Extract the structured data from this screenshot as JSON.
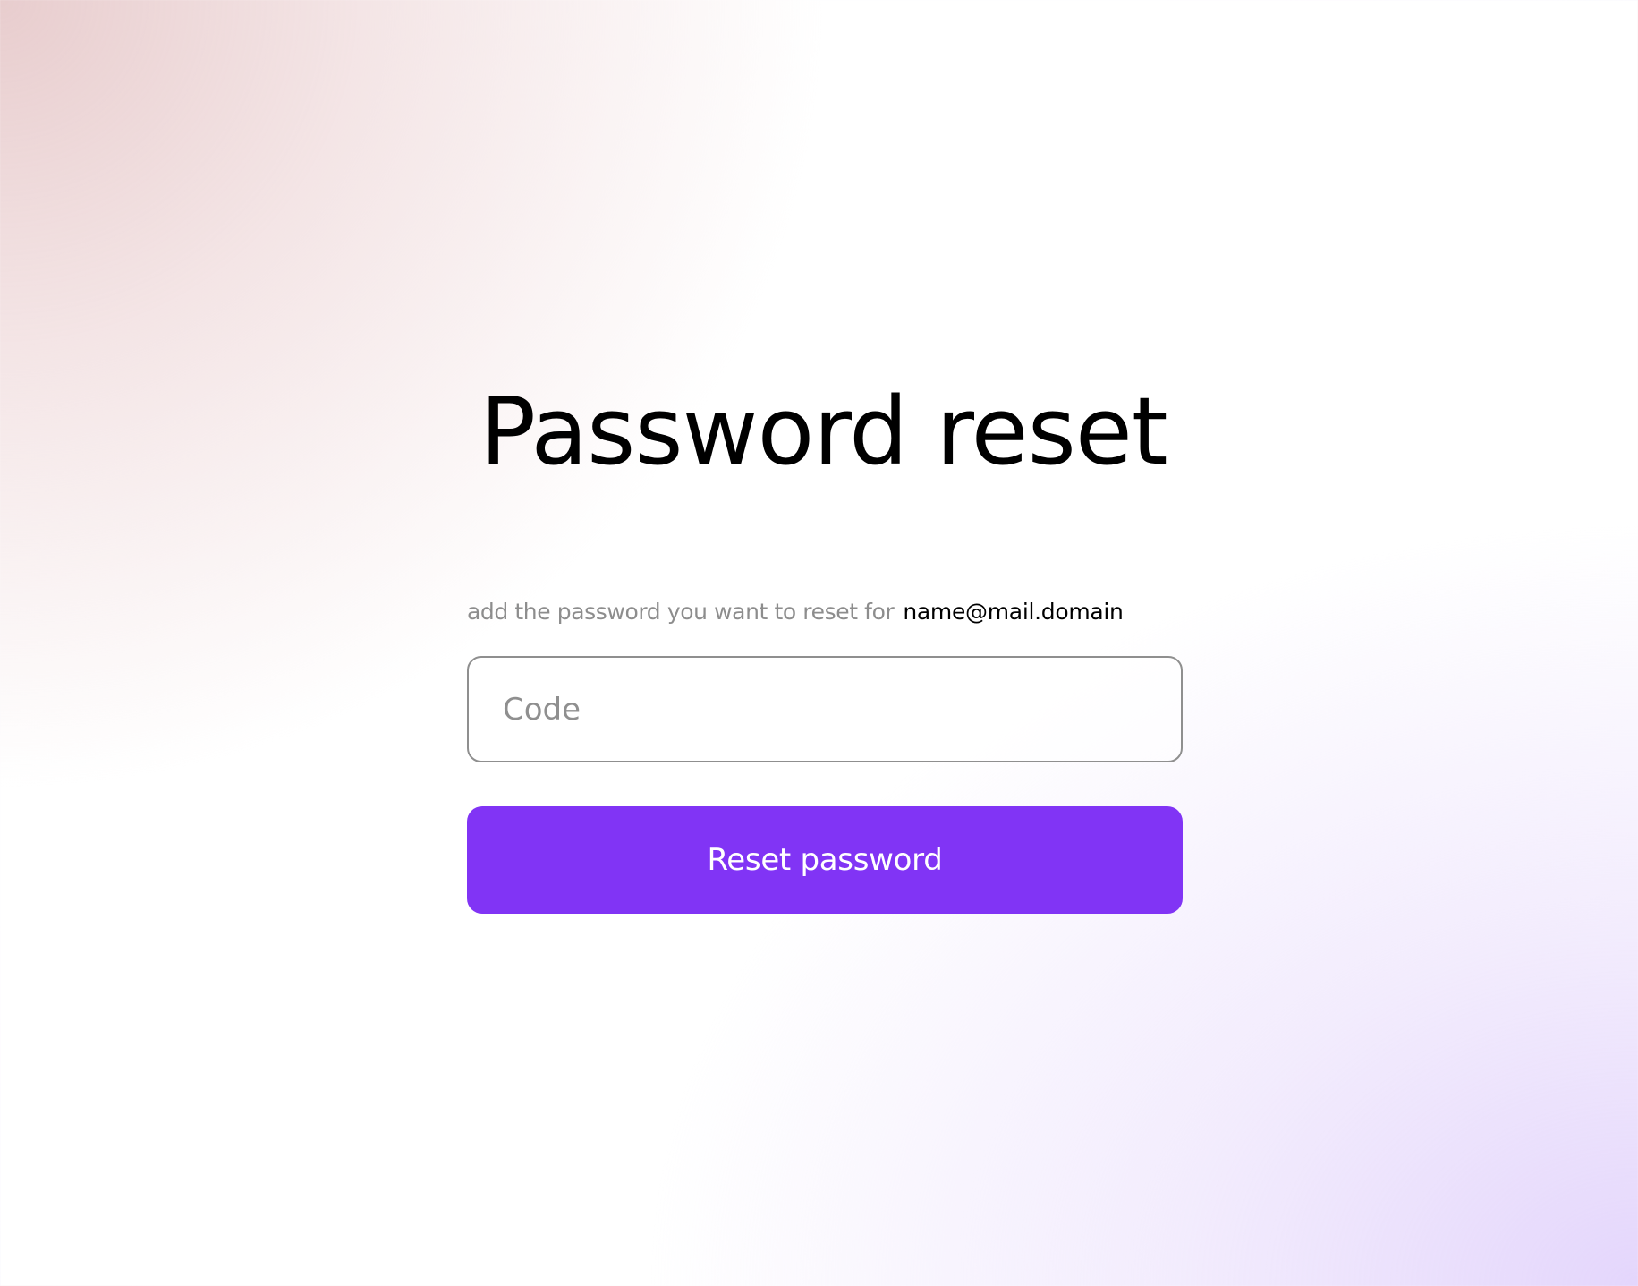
{
  "page": {
    "title": "Password reset"
  },
  "form": {
    "hint_text": "add the password you want to reset for",
    "email": "name@mail.domain",
    "code_input": {
      "placeholder": "Code",
      "value": ""
    },
    "submit_label": "Reset password"
  },
  "colors": {
    "accent": "#8134f5",
    "text_primary": "#000000",
    "text_muted": "#8d8d8d",
    "input_border": "#8f8f8f"
  }
}
